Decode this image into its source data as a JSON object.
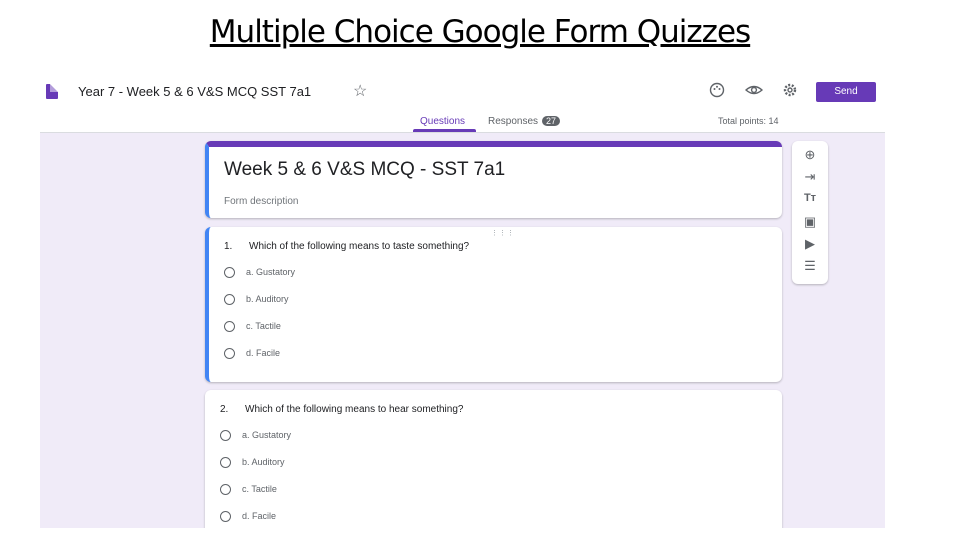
{
  "slide": {
    "title": "Multiple Choice Google Form Quizzes"
  },
  "topbar": {
    "doc_title": "Year 7 - Week 5 & 6 V&S MCQ SST 7a1",
    "send_label": "Send",
    "icons": [
      "doc-icon",
      "star-icon",
      "palette-icon",
      "eye-icon",
      "gear-icon"
    ]
  },
  "tabs": [
    {
      "label": "Questions",
      "active": true
    },
    {
      "label": "Responses",
      "badge": "27",
      "active": false
    }
  ],
  "total_points": "Total points: 14",
  "form": {
    "title": "Week 5 & 6 V&S MCQ - SST 7a1",
    "description": "Form description"
  },
  "questions": [
    {
      "number": "1.",
      "text": "Which of the following means to taste something?",
      "options": [
        "a. Gustatory",
        "b. Auditory",
        "c. Tactile",
        "d. Facile"
      ]
    },
    {
      "number": "2.",
      "text": "Which of the following means to hear something?",
      "options": [
        "a. Gustatory",
        "b. Auditory",
        "c. Tactile",
        "d. Facile"
      ]
    }
  ],
  "side_toolbar": [
    "add-question-icon",
    "import-questions-icon",
    "add-title-icon",
    "add-image-icon",
    "add-video-icon",
    "add-section-icon"
  ],
  "colors": {
    "accent": "#673ab7",
    "background": "#f0ebf8",
    "focus": "#4285f4"
  }
}
